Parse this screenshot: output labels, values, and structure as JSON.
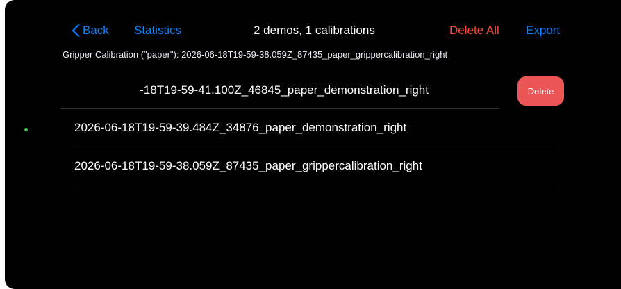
{
  "nav": {
    "back_label": "Back",
    "statistics_label": "Statistics",
    "title": "2 demos, 1 calibrations",
    "delete_all_label": "Delete All",
    "export_label": "Export"
  },
  "calibration": {
    "text": "Gripper Calibration (\"paper\"): 2026-06-18T19-59-38.059Z_87435_paper_grippercalibration_right"
  },
  "recordings": [
    {
      "name": "-18T19-59-41.100Z_46845_paper_demonstration_right",
      "swiped": true,
      "action_label": "Delete"
    },
    {
      "name": "2026-06-18T19-59-39.484Z_34876_paper_demonstration_right",
      "swiped": false
    },
    {
      "name": "2026-06-18T19-59-38.059Z_87435_paper_grippercalibration_right",
      "swiped": false
    }
  ],
  "colors": {
    "background": "#000000",
    "accent": "#0a84ff",
    "destructive": "#ff453a",
    "delete_button": "#ec5555",
    "status_dot": "#34c759",
    "separator": "#38383a"
  },
  "icons": {
    "back": "chevron-left-icon",
    "status": "green-dot-indicator"
  }
}
